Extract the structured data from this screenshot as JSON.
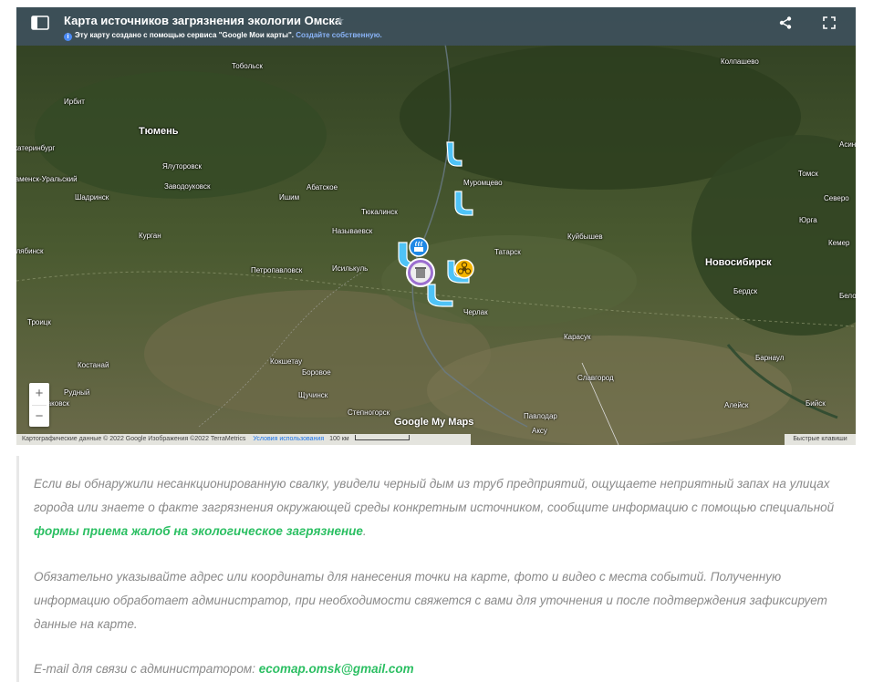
{
  "map": {
    "title": "Карта источников загрязнения экологии Омска",
    "subtitle": "Эту карту создано с помощью сервиса \"Google Мои карты\".",
    "create_link": "Создайте собственную.",
    "zoom_in": "+",
    "zoom_out": "−",
    "logo": "Google My Maps",
    "footer": {
      "copyright": "Картографические данные © 2022 Google Изображения ©2022 TerraMetrics",
      "terms": "Условия использования",
      "scale": "100 км"
    },
    "quick_keys": "Быстрые клавиши",
    "places": [
      {
        "name": "Тобольск"
      },
      {
        "name": "Колпашево"
      },
      {
        "name": "Ирбит"
      },
      {
        "name": "Тюмень",
        "big": true
      },
      {
        "name": "Асино"
      },
      {
        "name": "Ялуторовск"
      },
      {
        "name": "Муромцево"
      },
      {
        "name": "Томск"
      },
      {
        "name": "Заводоуковск"
      },
      {
        "name": "Абатское"
      },
      {
        "name": "Шадринск"
      },
      {
        "name": "Ишим"
      },
      {
        "name": "Северо"
      },
      {
        "name": "Тюкалинск"
      },
      {
        "name": "Юрга"
      },
      {
        "name": "Называевск"
      },
      {
        "name": "Курган"
      },
      {
        "name": "Куйбышев"
      },
      {
        "name": "Кемер"
      },
      {
        "name": "Татарск"
      },
      {
        "name": "Петропавловск"
      },
      {
        "name": "Исилькуль"
      },
      {
        "name": "Новосибирск",
        "big": true
      },
      {
        "name": "Бердск"
      },
      {
        "name": "Троицк"
      },
      {
        "name": "Черлак"
      },
      {
        "name": "Карасук"
      },
      {
        "name": "Барнаул"
      },
      {
        "name": "Костанай"
      },
      {
        "name": "Кокшетау"
      },
      {
        "name": "Боровое"
      },
      {
        "name": "Славгород"
      },
      {
        "name": "Рудный"
      },
      {
        "name": "Щучинск"
      },
      {
        "name": "Алейск"
      },
      {
        "name": "Бийск"
      },
      {
        "name": "Степногорск"
      },
      {
        "name": "Павлодар"
      },
      {
        "name": "Аксу"
      },
      {
        "name": "Екатеринбург"
      },
      {
        "name": "Каменск-Уральский"
      },
      {
        "name": "Челябинск"
      },
      {
        "name": "Белово"
      },
      {
        "name": "Лисаковск"
      }
    ]
  },
  "text": {
    "para1_before": "Если вы обнаружили несанкционированную свалку, увидели черный дым из труб предприятий, ощущаете неприятный запах на улицах города или знаете о факте загрязнения окружающей среды конкретным источником, сообщите информацию с помощью специальной ",
    "para1_link": "формы приема жалоб на экологическое загрязнение",
    "para1_after": ".",
    "para2": "Обязательно указывайте адрес или координаты для нанесения точки на карте, фото и видео с места событий. Полученную информацию обработает администратор, при необходимости свяжется с вами для уточнения и после подтверждения зафиксирует данные на карте.",
    "para3_before": "E-mail для связи с администратором: ",
    "para3_email": "ecomap.omsk@gmail.com"
  },
  "colors": {
    "header_bg": "#3e505c",
    "link_green": "#2bbf62",
    "text_gray": "#8a8a8a",
    "marker_blue": "#4fc3f7",
    "marker_yellow": "#f5b400",
    "marker_purple": "#9c6fd0"
  },
  "icons": {
    "panel": "sidebar-panel-icon",
    "share": "share-icon",
    "fullscreen": "fullscreen-icon",
    "star": "star-icon",
    "info": "info-icon"
  }
}
